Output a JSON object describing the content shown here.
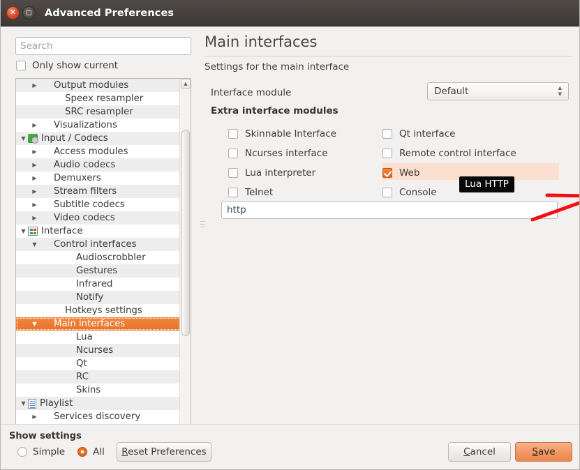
{
  "window": {
    "title": "Advanced Preferences",
    "close_icon": "close-icon",
    "maximize_icon": "maximize-icon"
  },
  "sidebar": {
    "search_placeholder": "Search",
    "search_value": "",
    "only_show_current": {
      "label": "Only show current",
      "checked": false
    },
    "tree": [
      {
        "label": "Output modules",
        "indent": 1,
        "arrow": "collapsed",
        "icon": ""
      },
      {
        "label": "Speex resampler",
        "indent": 2,
        "arrow": "none",
        "icon": ""
      },
      {
        "label": "SRC resampler",
        "indent": 2,
        "arrow": "none",
        "icon": ""
      },
      {
        "label": "Visualizations",
        "indent": 1,
        "arrow": "collapsed",
        "icon": ""
      },
      {
        "label": "Input / Codecs",
        "indent": 0,
        "arrow": "expanded",
        "icon": "codecs-icon"
      },
      {
        "label": "Access modules",
        "indent": 1,
        "arrow": "collapsed",
        "icon": ""
      },
      {
        "label": "Audio codecs",
        "indent": 1,
        "arrow": "collapsed",
        "icon": ""
      },
      {
        "label": "Demuxers",
        "indent": 1,
        "arrow": "collapsed",
        "icon": ""
      },
      {
        "label": "Stream filters",
        "indent": 1,
        "arrow": "collapsed",
        "icon": ""
      },
      {
        "label": "Subtitle codecs",
        "indent": 1,
        "arrow": "collapsed",
        "icon": ""
      },
      {
        "label": "Video codecs",
        "indent": 1,
        "arrow": "collapsed",
        "icon": ""
      },
      {
        "label": "Interface",
        "indent": 0,
        "arrow": "expanded",
        "icon": "interface-icon"
      },
      {
        "label": "Control interfaces",
        "indent": 1,
        "arrow": "expanded",
        "icon": ""
      },
      {
        "label": "Audioscrobbler",
        "indent": 3,
        "arrow": "none",
        "icon": ""
      },
      {
        "label": "Gestures",
        "indent": 3,
        "arrow": "none",
        "icon": ""
      },
      {
        "label": "Infrared",
        "indent": 3,
        "arrow": "none",
        "icon": ""
      },
      {
        "label": "Notify",
        "indent": 3,
        "arrow": "none",
        "icon": ""
      },
      {
        "label": "Hotkeys settings",
        "indent": 2,
        "arrow": "none",
        "icon": ""
      },
      {
        "label": "Main interfaces",
        "indent": 1,
        "arrow": "expanded",
        "icon": "",
        "selected": true
      },
      {
        "label": "Lua",
        "indent": 3,
        "arrow": "none",
        "icon": ""
      },
      {
        "label": "Ncurses",
        "indent": 3,
        "arrow": "none",
        "icon": ""
      },
      {
        "label": "Qt",
        "indent": 3,
        "arrow": "none",
        "icon": ""
      },
      {
        "label": "RC",
        "indent": 3,
        "arrow": "none",
        "icon": ""
      },
      {
        "label": "Skins",
        "indent": 3,
        "arrow": "none",
        "icon": ""
      },
      {
        "label": "Playlist",
        "indent": 0,
        "arrow": "expanded",
        "icon": "playlist-icon"
      },
      {
        "label": "Services discovery",
        "indent": 1,
        "arrow": "collapsed",
        "icon": ""
      }
    ]
  },
  "main": {
    "title": "Main interfaces",
    "subtitle": "Settings for the main interface",
    "interface_module": {
      "label": "Interface module",
      "value": "Default"
    },
    "extra_modules_heading": "Extra interface modules",
    "checkboxes": [
      {
        "label": "Skinnable Interface",
        "checked": false,
        "column": 1
      },
      {
        "label": "Qt interface",
        "checked": false,
        "column": 2
      },
      {
        "label": "Ncurses interface",
        "checked": false,
        "column": 1
      },
      {
        "label": "Remote control interface",
        "checked": false,
        "column": 2
      },
      {
        "label": "Lua interpreter",
        "checked": false,
        "column": 1
      },
      {
        "label": "Web",
        "checked": true,
        "column": 2,
        "highlighted": true
      },
      {
        "label": "Telnet",
        "checked": false,
        "column": 1
      },
      {
        "label": "Console",
        "checked": false,
        "column": 2
      }
    ],
    "modules_field_value": "http",
    "tooltip": "Lua HTTP"
  },
  "footer": {
    "show_settings_label": "Show settings",
    "simple_label": "Simple",
    "all_label": "All",
    "selected_mode": "All",
    "reset_label": "Reset Preferences",
    "reset_mnemonic": "R",
    "cancel_label": "Cancel",
    "cancel_mnemonic": "C",
    "save_label": "Save",
    "save_mnemonic": "S"
  },
  "colors": {
    "accent_orange": "#e8722a",
    "highlight_row": "#fbdfd0",
    "titlebar": "#3c3835",
    "annotation_red": "#f21010",
    "tooltip_bg": "#080808"
  }
}
